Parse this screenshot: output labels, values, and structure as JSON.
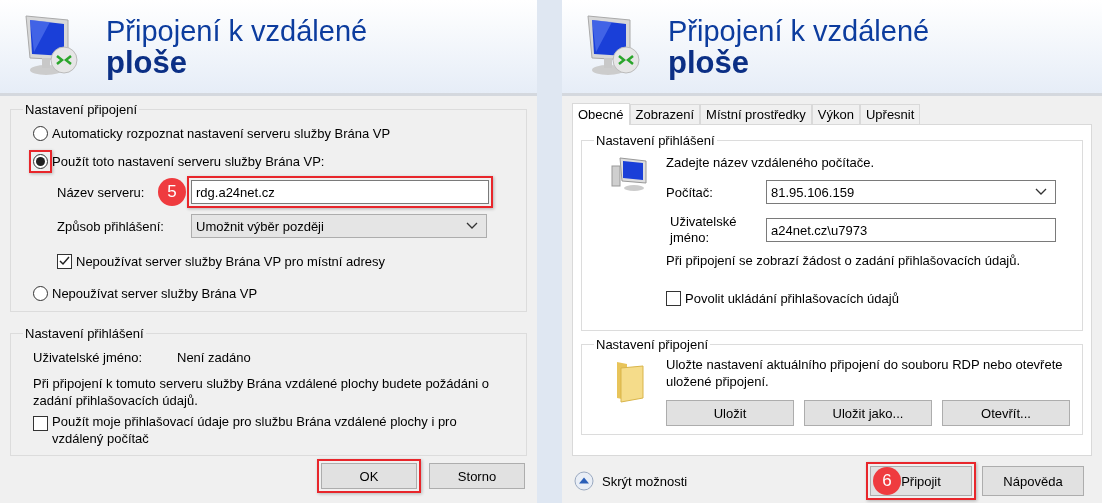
{
  "left_dialog": {
    "title": "Připojení k vzdálené",
    "title_bold": "ploše",
    "connection_group": {
      "legend": "Nastavení připojení",
      "items": [
        {
          "kind": "radio",
          "label": "Automaticky rozpoznat nastavení serveru služby Brána VP",
          "selected": false,
          "highlighted": false
        },
        {
          "kind": "radio",
          "label": "Použít toto nastavení serveru služby Brána VP:",
          "selected": true,
          "highlighted": true
        },
        {
          "kind": "field",
          "label": "Název serveru:",
          "value": "rdg.a24net.cz",
          "badge": "5",
          "highlighted": true
        },
        {
          "kind": "select",
          "label": "Způsob přihlášení:",
          "value": "Umožnit výběr později"
        },
        {
          "kind": "checkbox",
          "label": "Nepoužívat server služby Brána VP pro místní adresy",
          "checked": true
        },
        {
          "kind": "radio",
          "label": "Nepoužívat server služby Brána VP",
          "selected": false,
          "highlighted": false
        }
      ]
    },
    "login_group": {
      "legend": "Nastavení přihlášení",
      "username_label": "Uživatelské jméno:",
      "username_value": "Není zadáno",
      "note": "Při připojení k tomuto serveru služby Brána vzdálené plochy budete požádáni o zadání přihlašovacích údajů.",
      "checkbox": {
        "label": "Použít moje přihlašovací údaje pro službu Brána vzdálené plochy i pro vzdálený počítač",
        "checked": false
      }
    },
    "buttons": [
      {
        "label": "OK",
        "highlighted": true
      },
      {
        "label": "Storno",
        "highlighted": false
      }
    ]
  },
  "right_dialog": {
    "title": "Připojení k vzdálené",
    "title_bold": "ploše",
    "tabs": [
      {
        "label": "Obecné",
        "selected": true
      },
      {
        "label": "Zobrazení",
        "selected": false
      },
      {
        "label": "Místní prostředky",
        "selected": false
      },
      {
        "label": "Výkon",
        "selected": false
      },
      {
        "label": "Upřesnit",
        "selected": false
      }
    ],
    "login_group": {
      "legend": "Nastavení přihlášení",
      "prompt": "Zadejte název vzdáleného počítače.",
      "computer": {
        "label": "Počítač:",
        "value": "81.95.106.159"
      },
      "username": {
        "label": "Uživatelské jméno:",
        "value": "a24net.cz\\u7973"
      },
      "note": "Při připojení se zobrazí žádost o zadání přihlašovacích údajů.",
      "checkbox": {
        "label": "Povolit ukládání přihlašovacích údajů",
        "checked": false
      }
    },
    "connection_group": {
      "legend": "Nastavení připojení",
      "text": "Uložte nastavení aktuálního připojení do souboru RDP nebo otevřete uložené připojení.",
      "buttons": [
        "Uložit",
        "Uložit jako...",
        "Otevřít..."
      ]
    },
    "footer": {
      "toggle_label": "Skrýt možnosti",
      "buttons": [
        {
          "label": "Připojit",
          "highlighted": true,
          "badge": "6"
        },
        {
          "label": "Nápověda",
          "highlighted": false
        }
      ]
    }
  }
}
